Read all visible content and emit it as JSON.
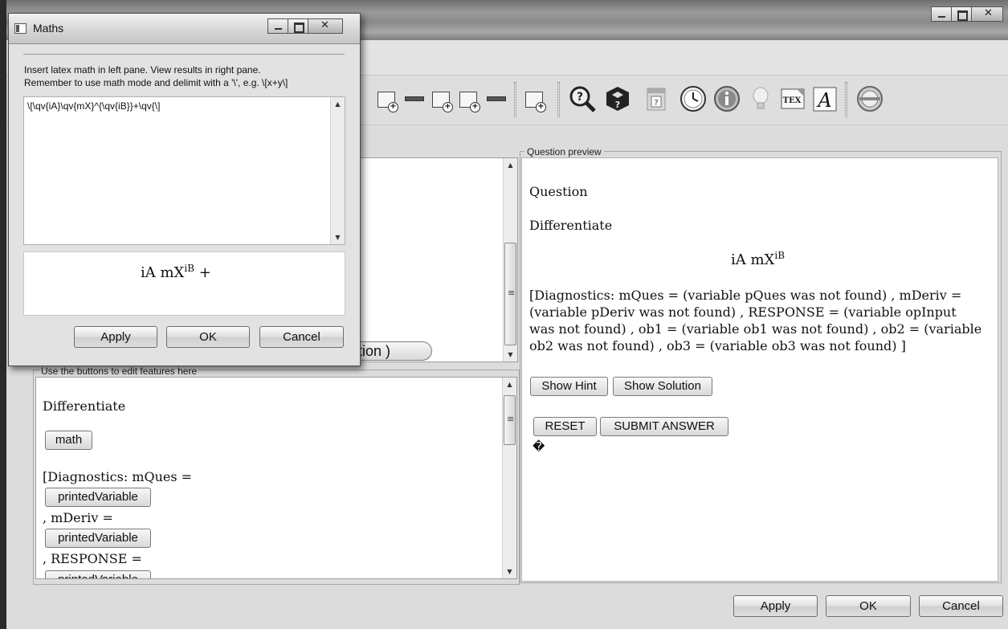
{
  "maths_dialog": {
    "title": "Maths",
    "instructions_line1": "Insert latex math in left pane. View results in right pane.",
    "instructions_line2": "Remember to use math mode and delimit with a '\\', e.g. \\[x+y\\]",
    "latex_input": "\\[\\qv{iA}\\qv{mX}^{\\qv{iB}}+\\qv{\\]",
    "preview_base": "iA mX",
    "preview_sup": "iB",
    "preview_tail": " +",
    "apply_label": "Apply",
    "ok_label": "OK",
    "cancel_label": "Cancel"
  },
  "behind_partial_button": "raction )",
  "editor_pane": {
    "legend": "Use the buttons to edit features here",
    "text_differentiate": "Differentiate",
    "math_button": "math",
    "diag_line": "[Diagnostics: mQues =",
    "printed_variable_1": "printedVariable",
    "mderiv_line": ", mDeriv =",
    "printed_variable_2": "printedVariable",
    "response_line": ", RESPONSE =",
    "printed_variable_3": "printedVariable"
  },
  "preview_pane": {
    "legend": "Question preview",
    "heading": "Question",
    "differentiate": "Differentiate",
    "formula_base": "iA mX",
    "formula_sup": "iB",
    "diagnostics": "[Diagnostics: mQues = (variable pQues was not found) , mDeriv = (variable pDeriv was not found) , RESPONSE = (variable opInput was not found) , ob1 = (variable ob1 was not found) , ob2 = (variable ob2 was not found) , ob3 = (variable ob3 was not found) ]",
    "show_hint": "Show Hint",
    "show_solution": "Show Solution",
    "reset": "RESET",
    "submit": "SUBMIT ANSWER",
    "unknown_glyph": "�"
  },
  "footer": {
    "apply_label": "Apply",
    "ok_label": "OK",
    "cancel_label": "Cancel"
  },
  "toolbar": {
    "tex_label": "TEX",
    "font_label": "A",
    "calendar_label": "?"
  }
}
